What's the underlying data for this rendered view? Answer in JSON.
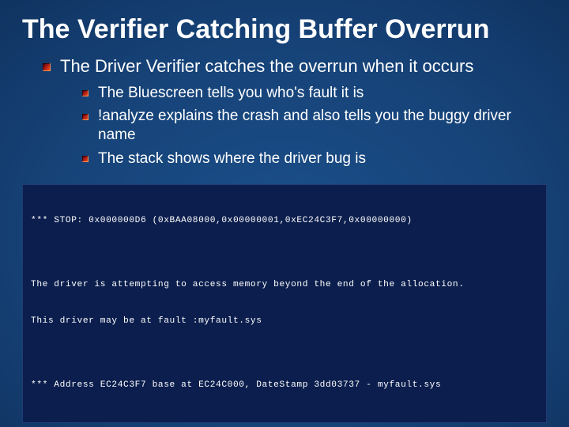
{
  "title": "The Verifier Catching Buffer Overrun",
  "bullets": {
    "main": "The Driver Verifier catches the overrun when it occurs",
    "subs": {
      "a": "The Bluescreen tells you who's fault it is",
      "b": "!analyze explains the crash and also tells you the buggy driver name",
      "c": "The stack shows where the driver bug is"
    }
  },
  "bsod": {
    "line1": "*** STOP: 0x000000D6 (0xBAA08000,0x00000001,0xEC24C3F7,0x00000000)",
    "line2": "The driver is attempting to access memory beyond the end of the allocation.",
    "line3": "This driver may be at fault :myfault.sys",
    "line4": "*** Address EC24C3F7 base at EC24C000, DateStamp 3dd03737 - myfault.sys"
  }
}
